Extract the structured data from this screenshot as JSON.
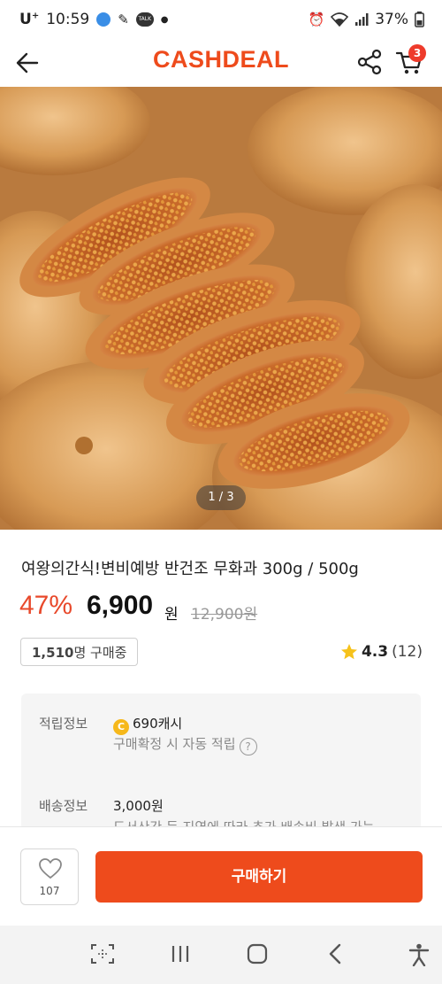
{
  "status_bar": {
    "carrier": "U",
    "carrier_sup": "+",
    "time": "10:59",
    "battery": "37%"
  },
  "header": {
    "logo": "CASHDEAL",
    "cart_count": "3"
  },
  "gallery": {
    "counter": "1 / 3"
  },
  "product": {
    "title": "여왕의간식!변비예방 반건조 무화과 300g / 500g",
    "discount": "47%",
    "price": "6,900",
    "price_unit": "원",
    "original_price": "12,900원",
    "buyers_count": "1,510",
    "buyers_suffix": "명 구매중",
    "rating": "4.3",
    "review_count": "(12)"
  },
  "info": {
    "points_label": "적립정보",
    "points_value": "690캐시",
    "points_note": "구매확정 시 자동 적립",
    "coin_symbol": "C",
    "shipping_label": "배송정보",
    "shipping_value": "3,000원",
    "shipping_note": "도서산간 등 지역에 따라 추가 배송비 발생 가능"
  },
  "bottom": {
    "like_count": "107",
    "buy_label": "구매하기"
  },
  "colors": {
    "brand": "#ee4b1c",
    "discount": "#e8492b",
    "badge": "#ee3b2b"
  }
}
